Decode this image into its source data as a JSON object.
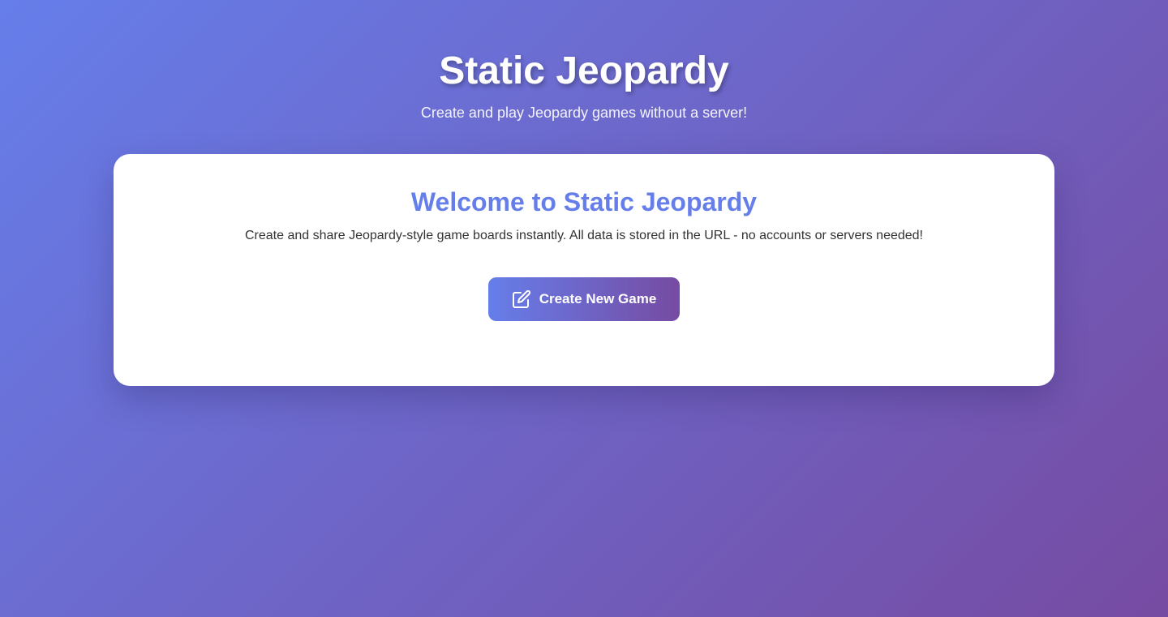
{
  "header": {
    "title": "Static Jeopardy",
    "subtitle": "Create and play Jeopardy games without a server!"
  },
  "welcome": {
    "title": "Welcome to Static Jeopardy",
    "description": "Create and share Jeopardy-style game boards instantly. All data is stored in the URL - no accounts or servers needed!",
    "create_button": {
      "label": "Create New Game",
      "icon": "edit-icon"
    }
  },
  "colors": {
    "gradient_start": "#667eea",
    "gradient_end": "#764ba2",
    "accent": "#667eea",
    "card_background": "#ffffff",
    "text": "#333333"
  }
}
